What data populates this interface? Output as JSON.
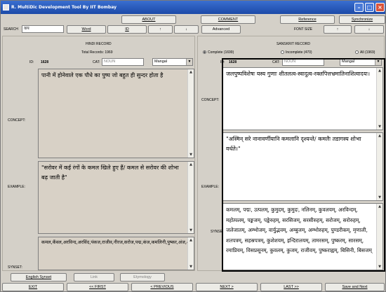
{
  "window": {
    "title": "R. MultiDic Development Tool By IIT Bombay"
  },
  "menubar": {
    "about": "ABOUT",
    "comment": "COMMENT",
    "reference": "Reference",
    "synchronize": "Synchronize"
  },
  "toolbar": {
    "search_label": "SEARCH",
    "search_value": "वाय",
    "word_btn": "Word",
    "id_btn": "ID",
    "prev_btn": "↑",
    "next_btn": "↓",
    "advanced_btn": "Advanced",
    "fontsize_label": "FONT SIZE",
    "font_up": "↑",
    "font_down": "↓"
  },
  "hindi": {
    "header": "HINDI RECORD",
    "total": "Total Records: 1969",
    "id_label": "ID:",
    "id_value": "1628",
    "cat_label": "CAT:",
    "cat_value": "NOUN",
    "font_value": "Mangal",
    "concept_label": "CONCEPT:",
    "concept": "पानी में होनेवाले एक पौधे का पुष्प जो बहुत ही सुन्दर होता है",
    "example_label": "EXAMPLE:",
    "example": "\"सरोवर में कई रंगों के कमल खिले हुए हैं/ कमल से सरोवर की शोभा बढ़ जाती है\"",
    "synset_label": "SYNSET:",
    "synset": "कमल,कँवल,अरविन्द,अरविंद,पंकज,राजीव,नीरज,सरोज,पद्म,कंज,कमलिनी,पुष्कर,अंज,अंभोज,अम्भोज,अंबुज,अम्बुज,कुंद,कुन्द,अब्ज,इंदीवर,पंकजात,पंकजन्मा,वारिरुह,जलरुह,पाथोज,पिंडपुष्प,पिण्डपुष्प,प्रफुल्ल,प्रफुल्ला,राजीव,जलज,नलिन,धूम,श्रीवास,श्रीवासक,पयोज,अर्कबंधु,अर्कबन्धु,जलरुह,श्रीशेष,श्रीधाम,राशिपुष्प,शतपत्र,रवीष्ट,रवीन्द,शतदल"
  },
  "sanskrit": {
    "header": "SANSKRIT RECORD",
    "complete": "Complete (1699)",
    "incomplete": "Incomplete (470)",
    "all": "All (1969)",
    "id_label": "ID:",
    "id_value": "1628",
    "cat_label": "CAT:",
    "cat_value": "NOUN",
    "font_value": "Mangal",
    "concept_label": "CONCEPT:",
    "concept": "जलपुष्पविशेषः यस्य गुणाः शीतलत्व-स्वादुत्व-रक्तपित्तभ्रमातिनाशित्वादयः।",
    "example_label": "EXAMPLE:",
    "example": "\"अस्मिन् सरे नानावर्णीयानि कमलानि दृश्यन्ते/ कमलैः तडागस्य शोभा वर्धते।\"",
    "synset_label": "SYNSET:",
    "synset": "कमलम्, पद्मः, उत्पलम्, कुमुदम्, कुमुदः, नलिनम्, कुवलयम्, अरविन्दम्, महोत्पलम्, पङ्कजम्, पङ्केरुहम्, सरसिजम्, सरसीरुहम्, सरोजम्, सरोरुहम्, जलेजातम्, अम्भोजम्, वार्युद्भवम्, अम्बुजम्, अम्भोरुहम्, पुण्डरीकम्, मृणाली, शतपत्रम्, सहस्रपत्रम्, कुशेशयम्, इन्दिरालयम्, तामरसम्, पुष्करम्, सारसम्, रमाप्रियम्, विसप्रसूनम्, कुवलम्, कुजम्, राजीवम्, पुष्कराह्वम्, बिसिनी, बिसजम्"
  },
  "bottom": {
    "english_synset": "English Synset",
    "link": "Link",
    "etymology": "Etymology",
    "exit": "EXIT",
    "first": "<< FIRST",
    "previous": "< PREVIOUS",
    "next": "NEXT >",
    "last": "LAST >>",
    "save": "Save and Next"
  },
  "colors": {
    "titlebar": "#1c4aa8",
    "highlight_box": "#d8d1c6",
    "window_bg": "#d4d0c8"
  }
}
